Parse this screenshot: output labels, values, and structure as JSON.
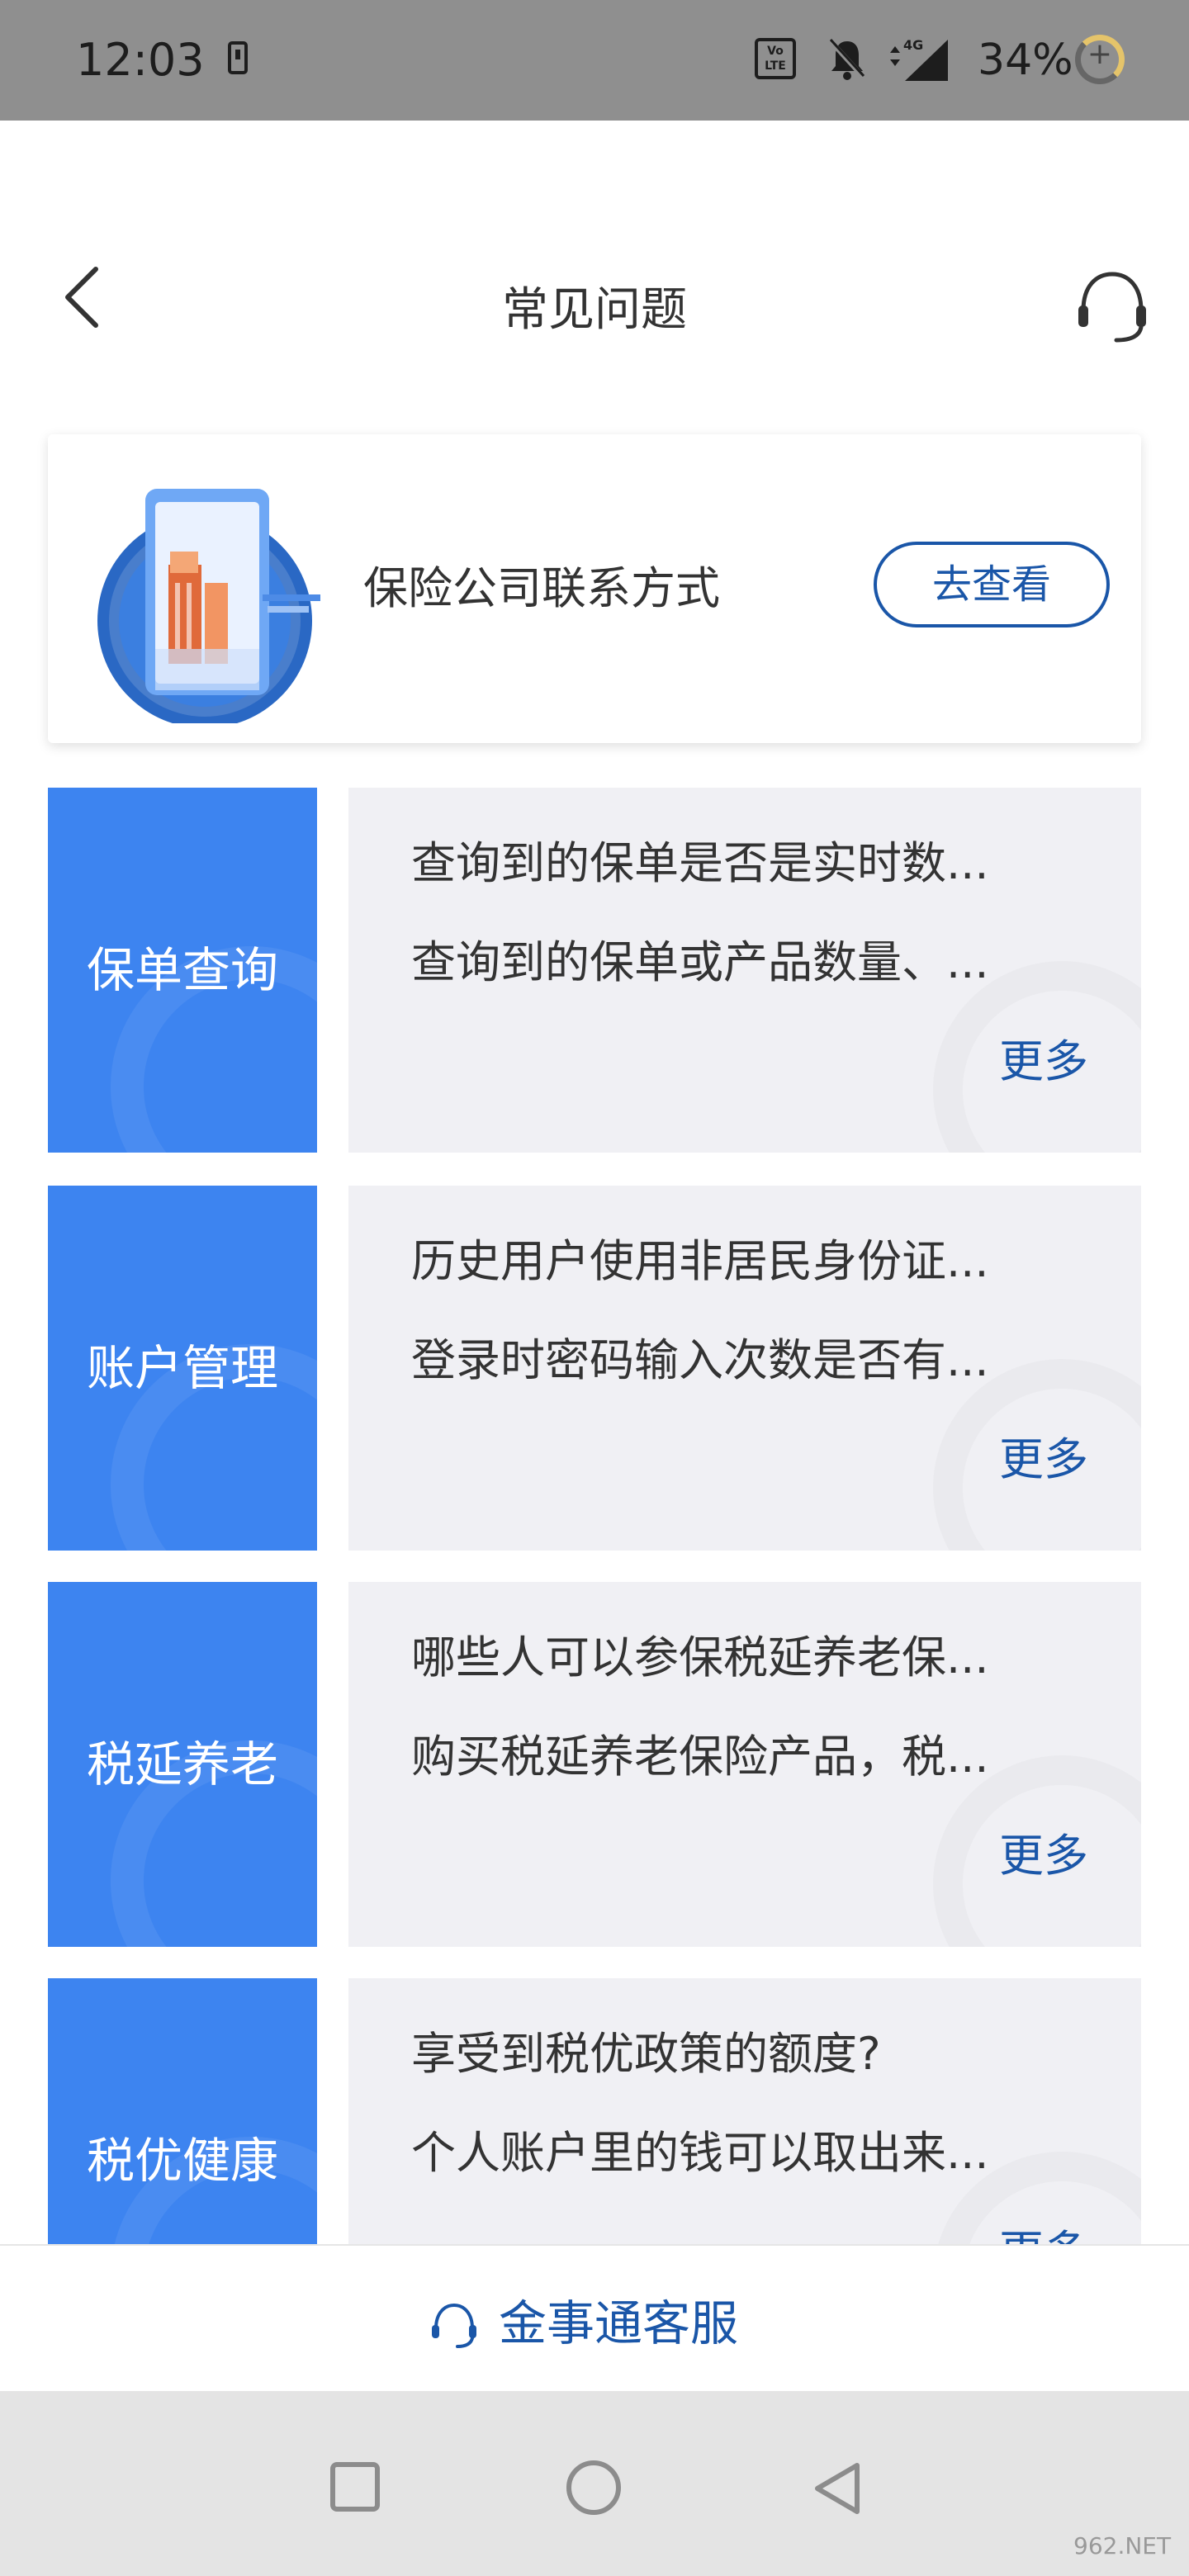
{
  "status_bar": {
    "time": "12:03",
    "volte": "Vo LTE",
    "network": "4G",
    "battery": "34%",
    "icons": [
      "download-icon",
      "volte-icon",
      "bell-muted-icon",
      "signal-icon",
      "battery-icon"
    ]
  },
  "header": {
    "title": "常见问题",
    "back_icon": "chevron-left-icon",
    "service_icon": "headset-icon"
  },
  "contact_card": {
    "label": "保险公司联系方式",
    "button": "去查看"
  },
  "faq_sections": [
    {
      "category": "保单查询",
      "q1": "查询到的保单是否是实时数...",
      "q2": "查询到的保单或产品数量、...",
      "more": "更多"
    },
    {
      "category": "账户管理",
      "q1": "历史用户使用非居民身份证...",
      "q2": "登录时密码输入次数是否有...",
      "more": "更多"
    },
    {
      "category": "税延养老",
      "q1": "哪些人可以参保税延养老保...",
      "q2": "购买税延养老保险产品，税...",
      "more": "更多"
    },
    {
      "category": "税优健康",
      "q1": "享受到税优政策的额度?",
      "q2": "个人账户里的钱可以取出来...",
      "more": "更多"
    }
  ],
  "bottom_bar": {
    "label": "金事通客服"
  },
  "system_nav": {
    "icons": [
      "recents-square-icon",
      "home-circle-icon",
      "back-triangle-icon"
    ]
  },
  "watermark": "962.NET",
  "colors": {
    "brand_blue": "#1a56a8",
    "category_blue": "#3d84f0",
    "status_bar": "#8f8f8f"
  }
}
